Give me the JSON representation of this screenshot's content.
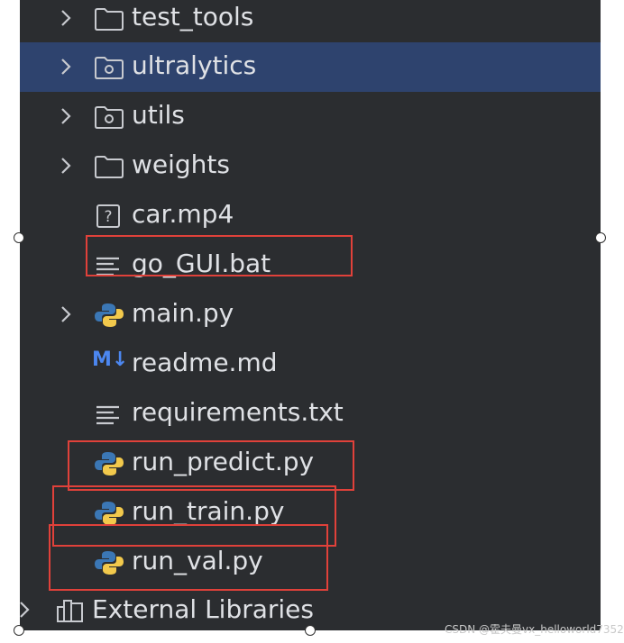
{
  "tree": {
    "items": [
      {
        "label": "test_tools",
        "icon": "folder-icon",
        "expandable": true
      },
      {
        "label": "ultralytics",
        "icon": "package-folder-icon",
        "expandable": true,
        "selected": true
      },
      {
        "label": "utils",
        "icon": "package-folder-icon",
        "expandable": true
      },
      {
        "label": "weights",
        "icon": "folder-icon",
        "expandable": true
      },
      {
        "label": "car.mp4",
        "icon": "unknown-file-icon",
        "expandable": false
      },
      {
        "label": "go_GUI.bat",
        "icon": "text-file-icon",
        "expandable": false,
        "highlighted": true
      },
      {
        "label": "main.py",
        "icon": "python-file-icon",
        "expandable": true
      },
      {
        "label": "readme.md",
        "icon": "markdown-file-icon",
        "expandable": false,
        "icon_text": "M↓"
      },
      {
        "label": "requirements.txt",
        "icon": "text-file-icon",
        "expandable": false
      },
      {
        "label": "run_predict.py",
        "icon": "python-file-icon",
        "expandable": false,
        "highlighted": true
      },
      {
        "label": "run_train.py",
        "icon": "python-file-icon",
        "expandable": false,
        "highlighted": true
      },
      {
        "label": "run_val.py",
        "icon": "python-file-icon",
        "expandable": false,
        "highlighted": true
      }
    ],
    "external": {
      "label": "External Libraries",
      "icon": "library-icon",
      "expandable": true
    }
  },
  "watermark": "CSDN @霍夫曼vx_helloworld7352",
  "colors": {
    "panel_bg": "#2b2d30",
    "selected_bg": "#2e436e",
    "text": "#dfe1e5",
    "highlight_box": "#e0413a",
    "python_blue": "#3b77b5",
    "python_yellow": "#f2c94c",
    "markdown_blue": "#4c87f0"
  }
}
